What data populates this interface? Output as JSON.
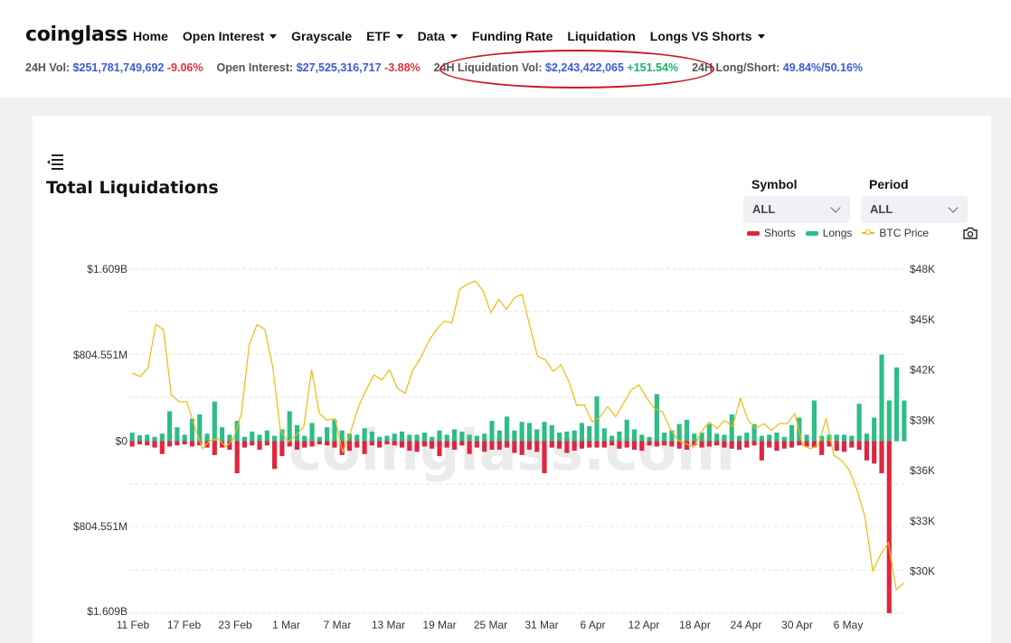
{
  "header": {
    "logo": "coinglass",
    "nav": [
      {
        "label": "Home",
        "dropdown": false
      },
      {
        "label": "Open Interest",
        "dropdown": true
      },
      {
        "label": "Grayscale",
        "dropdown": false
      },
      {
        "label": "ETF",
        "dropdown": true
      },
      {
        "label": "Data",
        "dropdown": true
      },
      {
        "label": "Funding Rate",
        "dropdown": false
      },
      {
        "label": "Liquidation",
        "dropdown": false
      },
      {
        "label": "Longs VS Shorts",
        "dropdown": true
      }
    ],
    "stats": {
      "vol_label": "24H Vol:",
      "vol_value": "$251,781,749,692",
      "vol_change": "-9.06%",
      "oi_label": "Open Interest:",
      "oi_value": "$27,525,316,717",
      "oi_change": "-3.88%",
      "liq_label": "24H Liquidation Vol:",
      "liq_value": "$2,243,422,065",
      "liq_change": "+151.54%",
      "ls_label": "24H Long/Short:",
      "ls_value": "49.84%/50.16%"
    }
  },
  "controls": {
    "symbol_label": "Symbol",
    "symbol_value": "ALL",
    "period_label": "Period",
    "period_value": "ALL"
  },
  "colors": {
    "shorts": "#e0253f",
    "longs": "#2ebd85",
    "btc": "#f2b90b"
  },
  "chart_data": {
    "type": "bar",
    "title": "Total Liquidations",
    "watermark": "coinglass.com",
    "legend": [
      "Shorts",
      "Longs",
      "BTC Price"
    ],
    "legend_position": "top-right",
    "grid": true,
    "left_ticks": [
      "$1.609B",
      "$804.551M",
      "$0",
      "$804.551M",
      "$1.609B"
    ],
    "right_ticks": [
      "$48K",
      "$45K",
      "$42K",
      "$39K",
      "$36K",
      "$33K",
      "$30K"
    ],
    "ylim_liquidations": [
      -1609000000,
      1609000000
    ],
    "ylim_btc": [
      27500,
      48000
    ],
    "x_tick_labels": [
      "11 Feb",
      "17 Feb",
      "23 Feb",
      "1 Mar",
      "7 Mar",
      "13 Mar",
      "19 Mar",
      "25 Mar",
      "31 Mar",
      "6 Apr",
      "12 Apr",
      "18 Apr",
      "24 Apr",
      "30 Apr",
      "6 May"
    ],
    "series": [
      {
        "name": "Longs",
        "unit": "USD M",
        "values": [
          80,
          55,
          60,
          40,
          70,
          280,
          130,
          60,
          210,
          250,
          70,
          370,
          130,
          60,
          190,
          40,
          90,
          60,
          100,
          50,
          110,
          280,
          150,
          50,
          170,
          40,
          130,
          200,
          100,
          70,
          60,
          120,
          90,
          40,
          50,
          70,
          90,
          60,
          60,
          80,
          40,
          100,
          60,
          110,
          90,
          60,
          50,
          70,
          190,
          100,
          230,
          100,
          180,
          170,
          110,
          180,
          150,
          80,
          90,
          100,
          170,
          140,
          420,
          120,
          50,
          90,
          200,
          110,
          60,
          40,
          440,
          80,
          100,
          160,
          200,
          70,
          80,
          160,
          70,
          60,
          250,
          50,
          80,
          160,
          50,
          60,
          80,
          40,
          150,
          220,
          60,
          380,
          50,
          60,
          60,
          60,
          50,
          350,
          70,
          220,
          810,
          380,
          690,
          380
        ]
      },
      {
        "name": "Shorts",
        "unit": "USD M",
        "values": [
          50,
          30,
          40,
          60,
          120,
          50,
          40,
          30,
          50,
          40,
          60,
          130,
          60,
          80,
          300,
          60,
          40,
          80,
          40,
          260,
          140,
          50,
          80,
          60,
          50,
          30,
          40,
          60,
          130,
          90,
          60,
          120,
          40,
          60,
          30,
          40,
          60,
          90,
          100,
          50,
          70,
          140,
          60,
          80,
          40,
          120,
          60,
          100,
          80,
          80,
          60,
          110,
          130,
          80,
          100,
          300,
          60,
          70,
          110,
          90,
          70,
          60,
          60,
          60,
          40,
          70,
          60,
          80,
          90,
          40,
          50,
          40,
          50,
          70,
          80,
          40,
          60,
          50,
          40,
          60,
          70,
          80,
          60,
          40,
          180,
          60,
          90,
          70,
          60,
          40,
          50,
          60,
          130,
          50,
          90,
          100,
          60,
          80,
          180,
          210,
          300,
          1609
        ]
      },
      {
        "name": "BTC Price",
        "unit": "USD",
        "values": [
          41800,
          41600,
          42100,
          44700,
          44400,
          40500,
          40100,
          40100,
          38600,
          37300,
          37800,
          37900,
          37400,
          37900,
          39400,
          43500,
          44700,
          44400,
          42200,
          38400,
          37700,
          38100,
          38600,
          42000,
          39400,
          39000,
          39100,
          37100,
          38300,
          39800,
          40800,
          41700,
          41400,
          42000,
          40900,
          40600,
          42000,
          42700,
          43700,
          44400,
          44900,
          44800,
          46800,
          47100,
          47300,
          46700,
          45400,
          46200,
          45600,
          46300,
          46500,
          44600,
          42800,
          42600,
          41900,
          42300,
          41300,
          39900,
          39900,
          38900,
          39200,
          39800,
          39200,
          40000,
          40800,
          41100,
          40300,
          39700,
          39500,
          38500,
          37800,
          37600,
          37400,
          38300,
          38900,
          38500,
          39000,
          38600,
          40300,
          39000,
          38500,
          38800,
          38400,
          38800,
          38800,
          39400,
          37500,
          37300,
          37500,
          39100,
          36900,
          36600,
          36000,
          34800,
          33200,
          30000,
          31000,
          31700,
          28900,
          29300
        ]
      }
    ]
  }
}
